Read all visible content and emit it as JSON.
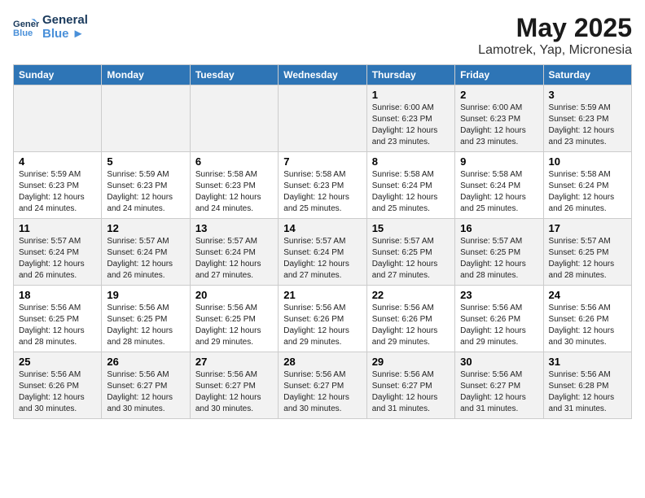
{
  "header": {
    "logo_line1": "General",
    "logo_line2": "Blue",
    "title": "May 2025",
    "subtitle": "Lamotrek, Yap, Micronesia"
  },
  "days_of_week": [
    "Sunday",
    "Monday",
    "Tuesday",
    "Wednesday",
    "Thursday",
    "Friday",
    "Saturday"
  ],
  "weeks": [
    [
      {
        "day": "",
        "info": ""
      },
      {
        "day": "",
        "info": ""
      },
      {
        "day": "",
        "info": ""
      },
      {
        "day": "",
        "info": ""
      },
      {
        "day": "1",
        "info": "Sunrise: 6:00 AM\nSunset: 6:23 PM\nDaylight: 12 hours\nand 23 minutes."
      },
      {
        "day": "2",
        "info": "Sunrise: 6:00 AM\nSunset: 6:23 PM\nDaylight: 12 hours\nand 23 minutes."
      },
      {
        "day": "3",
        "info": "Sunrise: 5:59 AM\nSunset: 6:23 PM\nDaylight: 12 hours\nand 23 minutes."
      }
    ],
    [
      {
        "day": "4",
        "info": "Sunrise: 5:59 AM\nSunset: 6:23 PM\nDaylight: 12 hours\nand 24 minutes."
      },
      {
        "day": "5",
        "info": "Sunrise: 5:59 AM\nSunset: 6:23 PM\nDaylight: 12 hours\nand 24 minutes."
      },
      {
        "day": "6",
        "info": "Sunrise: 5:58 AM\nSunset: 6:23 PM\nDaylight: 12 hours\nand 24 minutes."
      },
      {
        "day": "7",
        "info": "Sunrise: 5:58 AM\nSunset: 6:23 PM\nDaylight: 12 hours\nand 25 minutes."
      },
      {
        "day": "8",
        "info": "Sunrise: 5:58 AM\nSunset: 6:24 PM\nDaylight: 12 hours\nand 25 minutes."
      },
      {
        "day": "9",
        "info": "Sunrise: 5:58 AM\nSunset: 6:24 PM\nDaylight: 12 hours\nand 25 minutes."
      },
      {
        "day": "10",
        "info": "Sunrise: 5:58 AM\nSunset: 6:24 PM\nDaylight: 12 hours\nand 26 minutes."
      }
    ],
    [
      {
        "day": "11",
        "info": "Sunrise: 5:57 AM\nSunset: 6:24 PM\nDaylight: 12 hours\nand 26 minutes."
      },
      {
        "day": "12",
        "info": "Sunrise: 5:57 AM\nSunset: 6:24 PM\nDaylight: 12 hours\nand 26 minutes."
      },
      {
        "day": "13",
        "info": "Sunrise: 5:57 AM\nSunset: 6:24 PM\nDaylight: 12 hours\nand 27 minutes."
      },
      {
        "day": "14",
        "info": "Sunrise: 5:57 AM\nSunset: 6:24 PM\nDaylight: 12 hours\nand 27 minutes."
      },
      {
        "day": "15",
        "info": "Sunrise: 5:57 AM\nSunset: 6:25 PM\nDaylight: 12 hours\nand 27 minutes."
      },
      {
        "day": "16",
        "info": "Sunrise: 5:57 AM\nSunset: 6:25 PM\nDaylight: 12 hours\nand 28 minutes."
      },
      {
        "day": "17",
        "info": "Sunrise: 5:57 AM\nSunset: 6:25 PM\nDaylight: 12 hours\nand 28 minutes."
      }
    ],
    [
      {
        "day": "18",
        "info": "Sunrise: 5:56 AM\nSunset: 6:25 PM\nDaylight: 12 hours\nand 28 minutes."
      },
      {
        "day": "19",
        "info": "Sunrise: 5:56 AM\nSunset: 6:25 PM\nDaylight: 12 hours\nand 28 minutes."
      },
      {
        "day": "20",
        "info": "Sunrise: 5:56 AM\nSunset: 6:25 PM\nDaylight: 12 hours\nand 29 minutes."
      },
      {
        "day": "21",
        "info": "Sunrise: 5:56 AM\nSunset: 6:26 PM\nDaylight: 12 hours\nand 29 minutes."
      },
      {
        "day": "22",
        "info": "Sunrise: 5:56 AM\nSunset: 6:26 PM\nDaylight: 12 hours\nand 29 minutes."
      },
      {
        "day": "23",
        "info": "Sunrise: 5:56 AM\nSunset: 6:26 PM\nDaylight: 12 hours\nand 29 minutes."
      },
      {
        "day": "24",
        "info": "Sunrise: 5:56 AM\nSunset: 6:26 PM\nDaylight: 12 hours\nand 30 minutes."
      }
    ],
    [
      {
        "day": "25",
        "info": "Sunrise: 5:56 AM\nSunset: 6:26 PM\nDaylight: 12 hours\nand 30 minutes."
      },
      {
        "day": "26",
        "info": "Sunrise: 5:56 AM\nSunset: 6:27 PM\nDaylight: 12 hours\nand 30 minutes."
      },
      {
        "day": "27",
        "info": "Sunrise: 5:56 AM\nSunset: 6:27 PM\nDaylight: 12 hours\nand 30 minutes."
      },
      {
        "day": "28",
        "info": "Sunrise: 5:56 AM\nSunset: 6:27 PM\nDaylight: 12 hours\nand 30 minutes."
      },
      {
        "day": "29",
        "info": "Sunrise: 5:56 AM\nSunset: 6:27 PM\nDaylight: 12 hours\nand 31 minutes."
      },
      {
        "day": "30",
        "info": "Sunrise: 5:56 AM\nSunset: 6:27 PM\nDaylight: 12 hours\nand 31 minutes."
      },
      {
        "day": "31",
        "info": "Sunrise: 5:56 AM\nSunset: 6:28 PM\nDaylight: 12 hours\nand 31 minutes."
      }
    ]
  ]
}
